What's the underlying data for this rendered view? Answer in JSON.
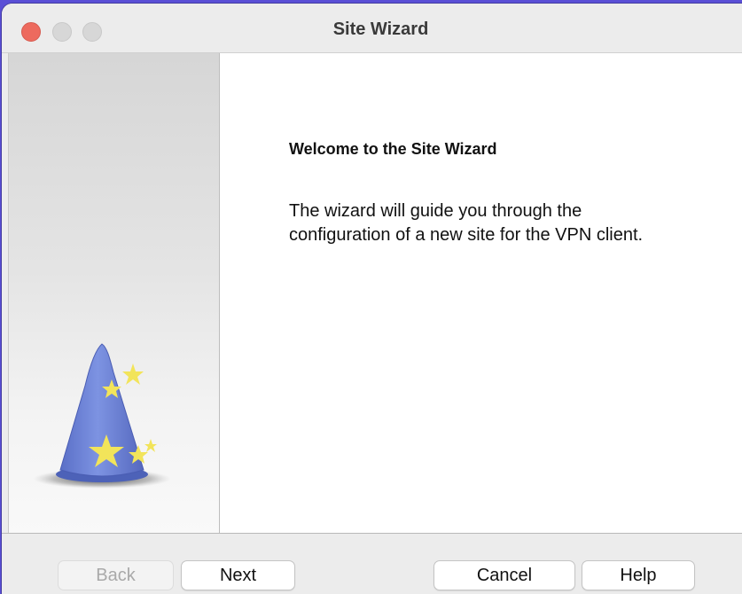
{
  "window": {
    "title": "Site Wizard"
  },
  "content": {
    "heading": "Welcome to the Site Wizard",
    "body": "The wizard will guide you through the configuration of a new site for the VPN client."
  },
  "footer": {
    "back_label": "Back",
    "next_label": "Next",
    "cancel_label": "Cancel",
    "help_label": "Help"
  },
  "illustration": {
    "icon": "wizard-hat-icon",
    "hat_color": "#6f86d8",
    "star_color": "#f2e45a"
  },
  "colors": {
    "close": "#ed6a5e",
    "inactive_light": "#d7d7d7"
  }
}
